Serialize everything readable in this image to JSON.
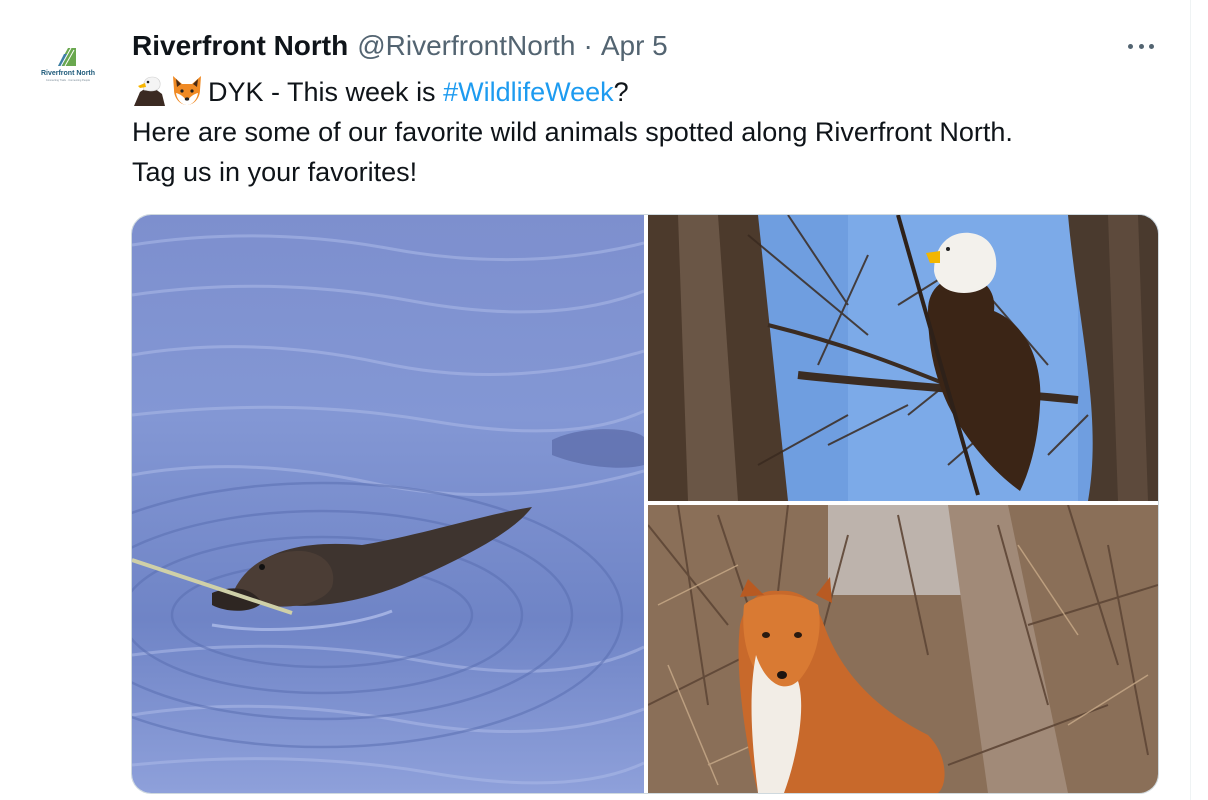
{
  "tweet": {
    "author_name": "Riverfront North",
    "author_handle": "@RiverfrontNorth",
    "separator": "·",
    "date": "Apr 5",
    "avatar_logo_name": "Riverfront North",
    "avatar_logo_tagline": "Connecting Trails · Connecting People",
    "text": {
      "line1_before_hashtag": "DYK - This week is ",
      "hashtag": "#WildlifeWeek",
      "line1_after_hashtag": "?",
      "line2": "Here are some of our favorite wild animals spotted along Riverfront North.",
      "line3": "Tag us in your favorites!"
    },
    "emojis": [
      "eagle-emoji",
      "fox-emoji"
    ],
    "media": [
      {
        "subject": "beaver"
      },
      {
        "subject": "bald-eagle"
      },
      {
        "subject": "red-fox"
      }
    ],
    "colors": {
      "link": "#1d9bf0",
      "secondary_text": "#536471",
      "primary_text": "#0f1419"
    }
  }
}
